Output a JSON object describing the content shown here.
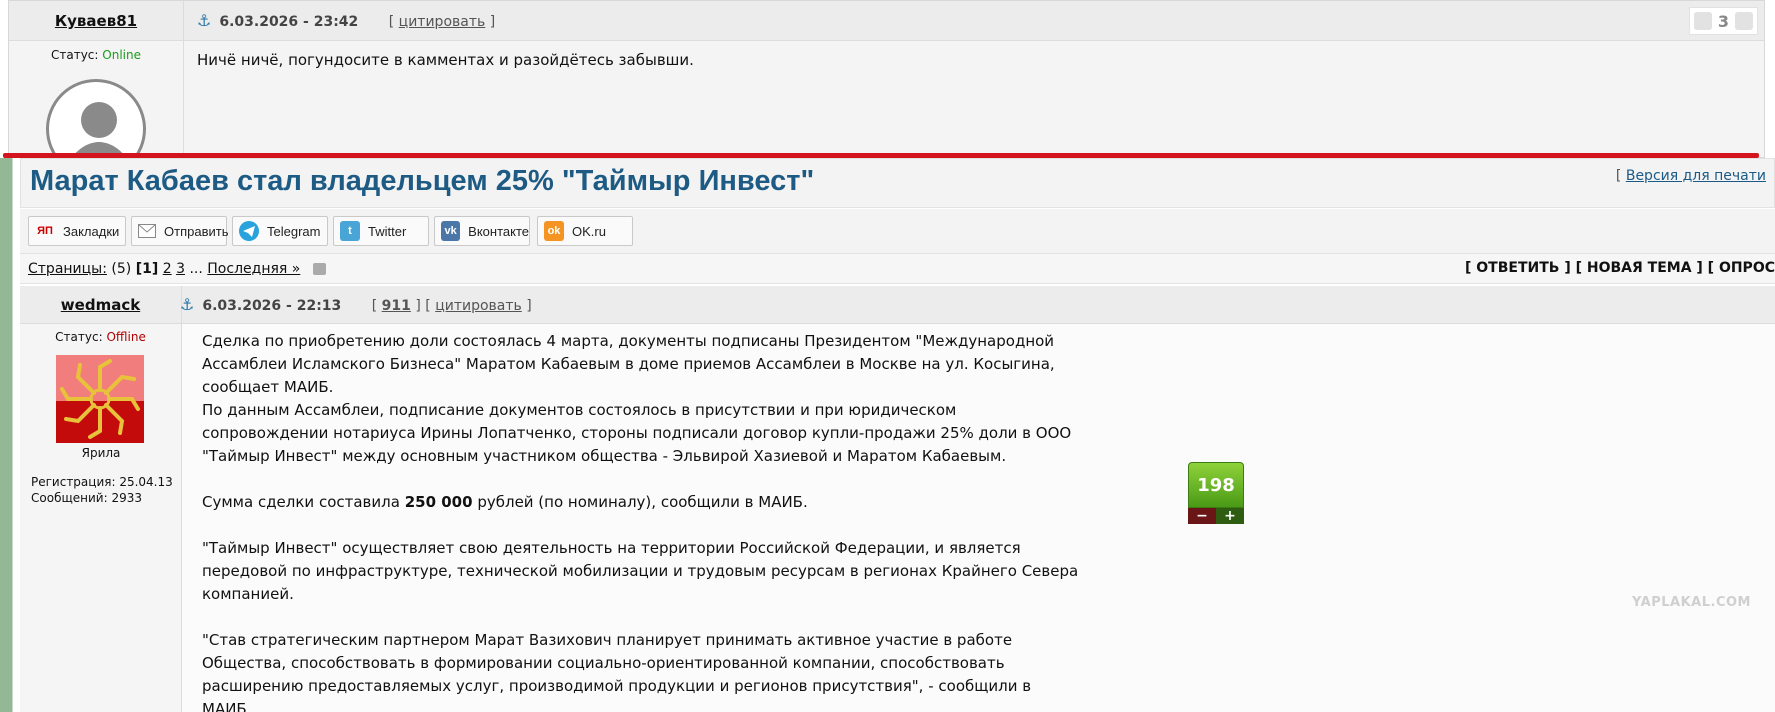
{
  "top_post": {
    "author": "Куваев81",
    "date": "6.03.2026 - 23:42",
    "quote_label": "цитировать",
    "karma_count": "3",
    "status_label": "Статус:",
    "status_value": "Online",
    "text": "Ничё ничё, погундосите в камментах и разойдётесь забывши."
  },
  "topic": {
    "title": "Марат Кабаев стал владельцем 25% \"Таймыр Инвест\"",
    "print_label": "Версия для печати"
  },
  "share": [
    {
      "label": "Закладки",
      "icon": "ya-bookmarks-icon",
      "color": "#ffffff"
    },
    {
      "label": "Отправить",
      "icon": "envelope-icon",
      "color": "#ffffff"
    },
    {
      "label": "Telegram",
      "icon": "telegram-icon",
      "color": "#2aa3dd"
    },
    {
      "label": "Twitter",
      "icon": "twitter-icon",
      "color": "#49a5d6"
    },
    {
      "label": "Вконтакте",
      "icon": "vk-icon",
      "color": "#4a76a8"
    },
    {
      "label": "OK.ru",
      "icon": "ok-icon",
      "color": "#f59323"
    }
  ],
  "pages": {
    "label": "Страницы:",
    "count": "(5)",
    "current": "1",
    "others": [
      "2",
      "3"
    ],
    "ellipsis": "...",
    "last": "Последняя »"
  },
  "topic_actions": "[ ОТВЕТИТЬ ] [ НОВАЯ ТЕМА ] [ ОПРОС",
  "post": {
    "author": "wedmack",
    "date": "6.03.2026 - 22:13",
    "post_num": "911",
    "quote_label": "цитировать",
    "status_label": "Статус:",
    "status_value": "Offline",
    "avatar_caption": "Ярила",
    "reg_label": "Регистрация: 25.04.13",
    "msg_label": "Сообщений: 2933",
    "rating": "198",
    "rating_minus": "−",
    "rating_plus": "+",
    "p1": "Сделка по приобретению доли состоялась 4 марта, документы подписаны Президентом \"Международной Ассамблеи Исламского Бизнеса\" Маратом Кабаевым в доме приемов Ассамблеи в Москве на ул. Косыгина, сообщает МАИБ.",
    "p2": "По данным Ассамблеи, подписание документов состоялось в присутствии и при юридическом сопровождении нотариуса Ирины Лопатченко, стороны подписали договор купли-продажи 25% доли в ООО \"Таймыр Инвест\" между основным участником общества - Эльвирой Хазиевой и Маратом Кабаевым.",
    "p3_pre": "Сумма сделки составила ",
    "p3_bold": "250 000",
    "p3_post": " рублей (по номиналу), сообщили в МАИБ.",
    "p4": "\"Таймыр Инвест\" осуществляет свою деятельность на территории Российской Федерации, и является передовой по инфраструктуре, технической мобилизации и трудовым ресурсам в регионах Крайнего Севера компанией.",
    "p5": "\"Став стратегическим партнером Марат Вазихович планирует принимать активное участие в работе Общества, способствовать в формировании социально-ориентированной компании, способствовать расширению предоставляемых услуг, производимой продукции и регионов присутствия\", - сообщили в МАИБ."
  },
  "watermark": "YAPLAKAL.COM"
}
